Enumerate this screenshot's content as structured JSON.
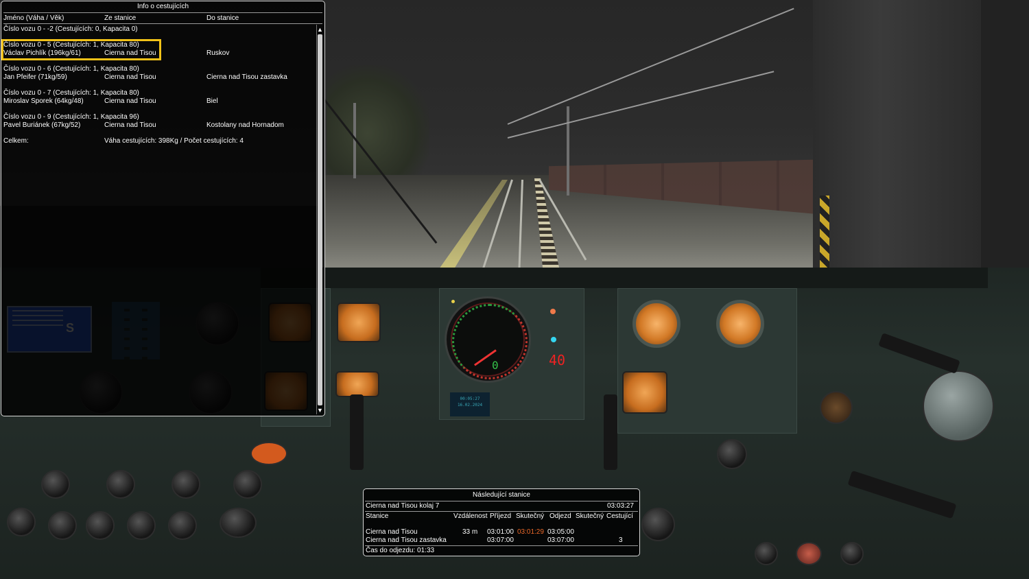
{
  "passenger_window": {
    "title": "Info o cestujících",
    "headers": {
      "name": "Jméno (Váha / Věk)",
      "from": "Ze stanice",
      "to": "Do stanice"
    },
    "cars": [
      {
        "car_line": "Číslo vozu 0 - -2 (Cestujících: 0, Kapacita 0)"
      },
      {
        "car_line": "Číslo vozu 0 - 5 (Cestujících: 1, Kapacita 80)",
        "name": "Václav Pichlík (196kg/61)",
        "from": "Cierna nad Tisou",
        "to": "Ruskov",
        "selected": true
      },
      {
        "car_line": "Číslo vozu 0 - 6 (Cestujících: 1, Kapacita 80)",
        "name": "Jan Pfeifer (71kg/59)",
        "from": "Cierna nad Tisou",
        "to": "Cierna nad Tisou zastavka"
      },
      {
        "car_line": "Číslo vozu 0 - 7 (Cestujících: 1, Kapacita 80)",
        "name": "Miroslav Sporek (64kg/48)",
        "from": "Cierna nad Tisou",
        "to": "Biel"
      },
      {
        "car_line": "Číslo vozu 0 - 9 (Cestujících: 1, Kapacita 96)",
        "name": "Pavel Buriánek (67kg/52)",
        "from": "Cierna nad Tisou",
        "to": "Kostolany nad Hornadom"
      }
    ],
    "total_label": "Celkem:",
    "total_value": "Váha cestujících: 398Kg / Počet cestujících: 4",
    "scroll_up": "▲",
    "scroll_down": "▼",
    "highlight_color": "#f2c218"
  },
  "next_station_window": {
    "title": "Následující stanice",
    "current_track": "Cierna nad Tisou kolaj 7",
    "clock": "03:03:27",
    "columns": {
      "station": "Stanice",
      "distance": "Vzdálenost",
      "arrival": "Příjezd",
      "actual_arrival": "Skutečný",
      "departure": "Odjezd",
      "actual_departure": "Skutečný",
      "passengers": "Cestující"
    },
    "rows": [
      {
        "station": "Cierna nad Tisou",
        "distance": "33 m",
        "arrival": "03:01:00",
        "actual_arrival": "03:01:29",
        "departure": "03:05:00",
        "actual_departure": "",
        "passengers": ""
      },
      {
        "station": "Cierna nad Tisou zastavka",
        "distance": "",
        "arrival": "03:07:00",
        "actual_arrival": "",
        "departure": "03:07:00",
        "actual_departure": "",
        "passengers": "3"
      }
    ],
    "time_to_departure": "Čas do odjezdu: 01:33",
    "late_color": "#ee6a2a"
  },
  "cab": {
    "speed_readout": "0",
    "speed_limit_readout": "40",
    "lcd_mode_letter": "S",
    "clock_display": [
      "00:05:27",
      "16.02.2024"
    ],
    "icons": [
      "speedometer-icon",
      "pressure-gauge-icon",
      "lever-icon",
      "knob-icon",
      "warning-lamp-icon"
    ]
  }
}
